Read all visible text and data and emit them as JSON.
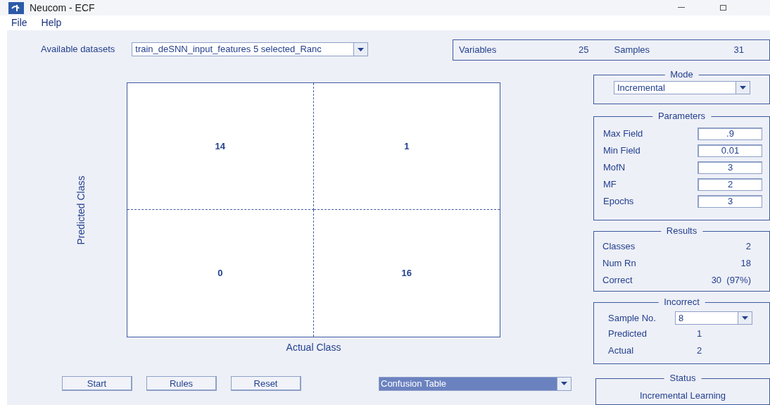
{
  "window": {
    "title": "Neucom - ECF"
  },
  "menu": [
    "File",
    "Help"
  ],
  "datasets": {
    "label": "Available datasets",
    "value": "train_deSNN_input_features 5 selected_Ranc"
  },
  "info": [
    {
      "label": "Variables",
      "value": "25"
    },
    {
      "label": "Samples",
      "value": "31"
    }
  ],
  "matrix": {
    "ylabel": "Predicted Class",
    "xlabel": "Actual Class",
    "cells": [
      [
        "14",
        "1"
      ],
      [
        "0",
        "16"
      ]
    ]
  },
  "buttons": [
    "Start",
    "Rules",
    "Reset"
  ],
  "view": {
    "value": "Confusion Table"
  },
  "mode": {
    "title": "Mode",
    "value": "Incremental"
  },
  "parameters": {
    "title": "Parameters",
    "fields": [
      {
        "label": "Max Field",
        "value": ".9"
      },
      {
        "label": "Min Field",
        "value": "0.01"
      },
      {
        "label": "MofN",
        "value": "3"
      },
      {
        "label": "MF",
        "value": "2"
      },
      {
        "label": "Epochs",
        "value": "3"
      }
    ]
  },
  "results": {
    "title": "Results",
    "rows": [
      {
        "label": "Classes",
        "value": "2"
      },
      {
        "label": "Num Rn",
        "value": "18"
      },
      {
        "label": "Correct",
        "value": "30  (97%)"
      }
    ]
  },
  "incorrect": {
    "title": "Incorrect",
    "sample_label": "Sample No.",
    "sample_value": "8",
    "rows": [
      {
        "label": "Predicted",
        "value": "1"
      },
      {
        "label": "Actual",
        "value": "2"
      }
    ]
  },
  "status": {
    "title": "Status",
    "text": "Incremental Learning"
  }
}
